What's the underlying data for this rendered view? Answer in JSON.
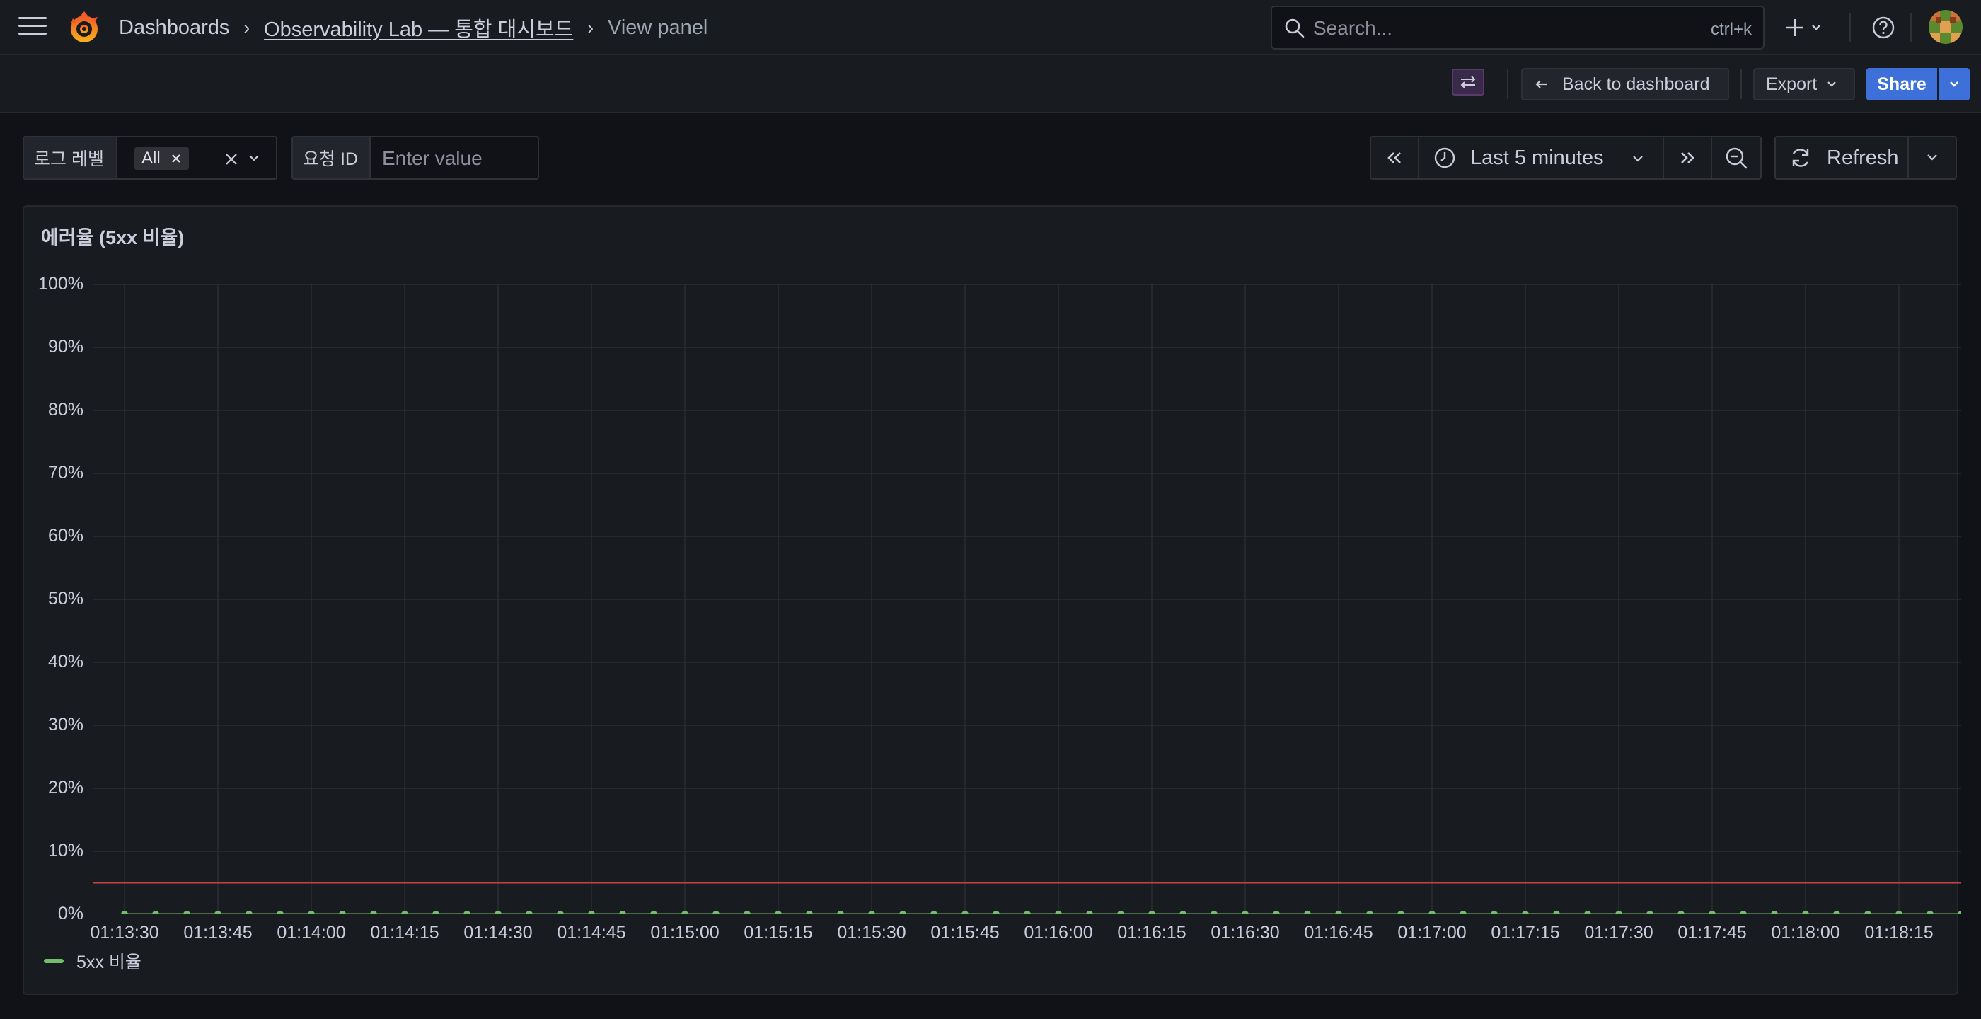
{
  "header": {
    "breadcrumbs": [
      "Dashboards",
      "Observability Lab — 통합 대시보드",
      "View panel"
    ],
    "search_placeholder": "Search...",
    "search_shortcut": "ctrl+k"
  },
  "toolbar": {
    "back_label": "Back to dashboard",
    "export_label": "Export",
    "share_label": "Share"
  },
  "variables": {
    "log_level_label": "로그 레벨",
    "log_level_value": "All",
    "request_id_label": "요청 ID",
    "request_id_placeholder": "Enter value"
  },
  "time_picker": {
    "range_label": "Last 5 minutes",
    "refresh_label": "Refresh"
  },
  "panel": {
    "title": "에러율 (5xx 비율)"
  },
  "colors": {
    "series": "#73bf69",
    "threshold": "#c4424a",
    "primary": "#3d71d9"
  },
  "chart_data": {
    "type": "line",
    "title": "에러율 (5xx 비율)",
    "y_ticks": [
      "0%",
      "10%",
      "20%",
      "30%",
      "40%",
      "50%",
      "60%",
      "70%",
      "80%",
      "90%",
      "100%"
    ],
    "x_ticks": [
      "01:13:30",
      "01:13:45",
      "01:14:00",
      "01:14:15",
      "01:14:30",
      "01:14:45",
      "01:15:00",
      "01:15:15",
      "01:15:30",
      "01:15:45",
      "01:16:00",
      "01:16:15",
      "01:16:30",
      "01:16:45",
      "01:17:00",
      "01:17:15",
      "01:17:30",
      "01:17:45",
      "01:18:00",
      "01:18:15"
    ],
    "ylim": [
      0,
      100
    ],
    "x_range": [
      "01:13:25",
      "01:18:25"
    ],
    "sample_interval_seconds": 5,
    "first_sample": "01:13:30",
    "series": [
      {
        "name": "5xx 비율",
        "constant_value": 0,
        "point_count": 60
      }
    ],
    "threshold": 5,
    "grid": true,
    "legend_position": "bottom-left"
  }
}
